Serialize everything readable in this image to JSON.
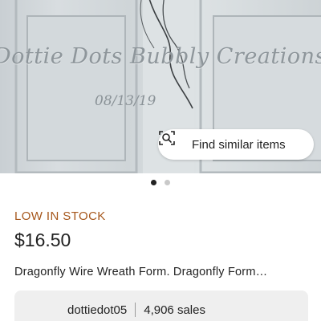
{
  "listing_image": {
    "watermark_text": "Dottie Dots Bubbly Creations created.",
    "watermark_date": "08/13/19",
    "find_similar_label": "Find similar items",
    "find_similar_icon": "visual-search-icon",
    "carousel": {
      "total": 2,
      "active_index": 1
    }
  },
  "listing": {
    "stock_status": "LOW IN STOCK",
    "price": "$16.50",
    "title": "Dragonfly Wire Wreath Form. Dragonfly Form…"
  },
  "shop": {
    "name": "dottiedot05",
    "sales": "4,906 sales"
  },
  "colors": {
    "stock_accent": "#a6571c",
    "text_primary": "#222222",
    "card_background": "#efefef"
  }
}
